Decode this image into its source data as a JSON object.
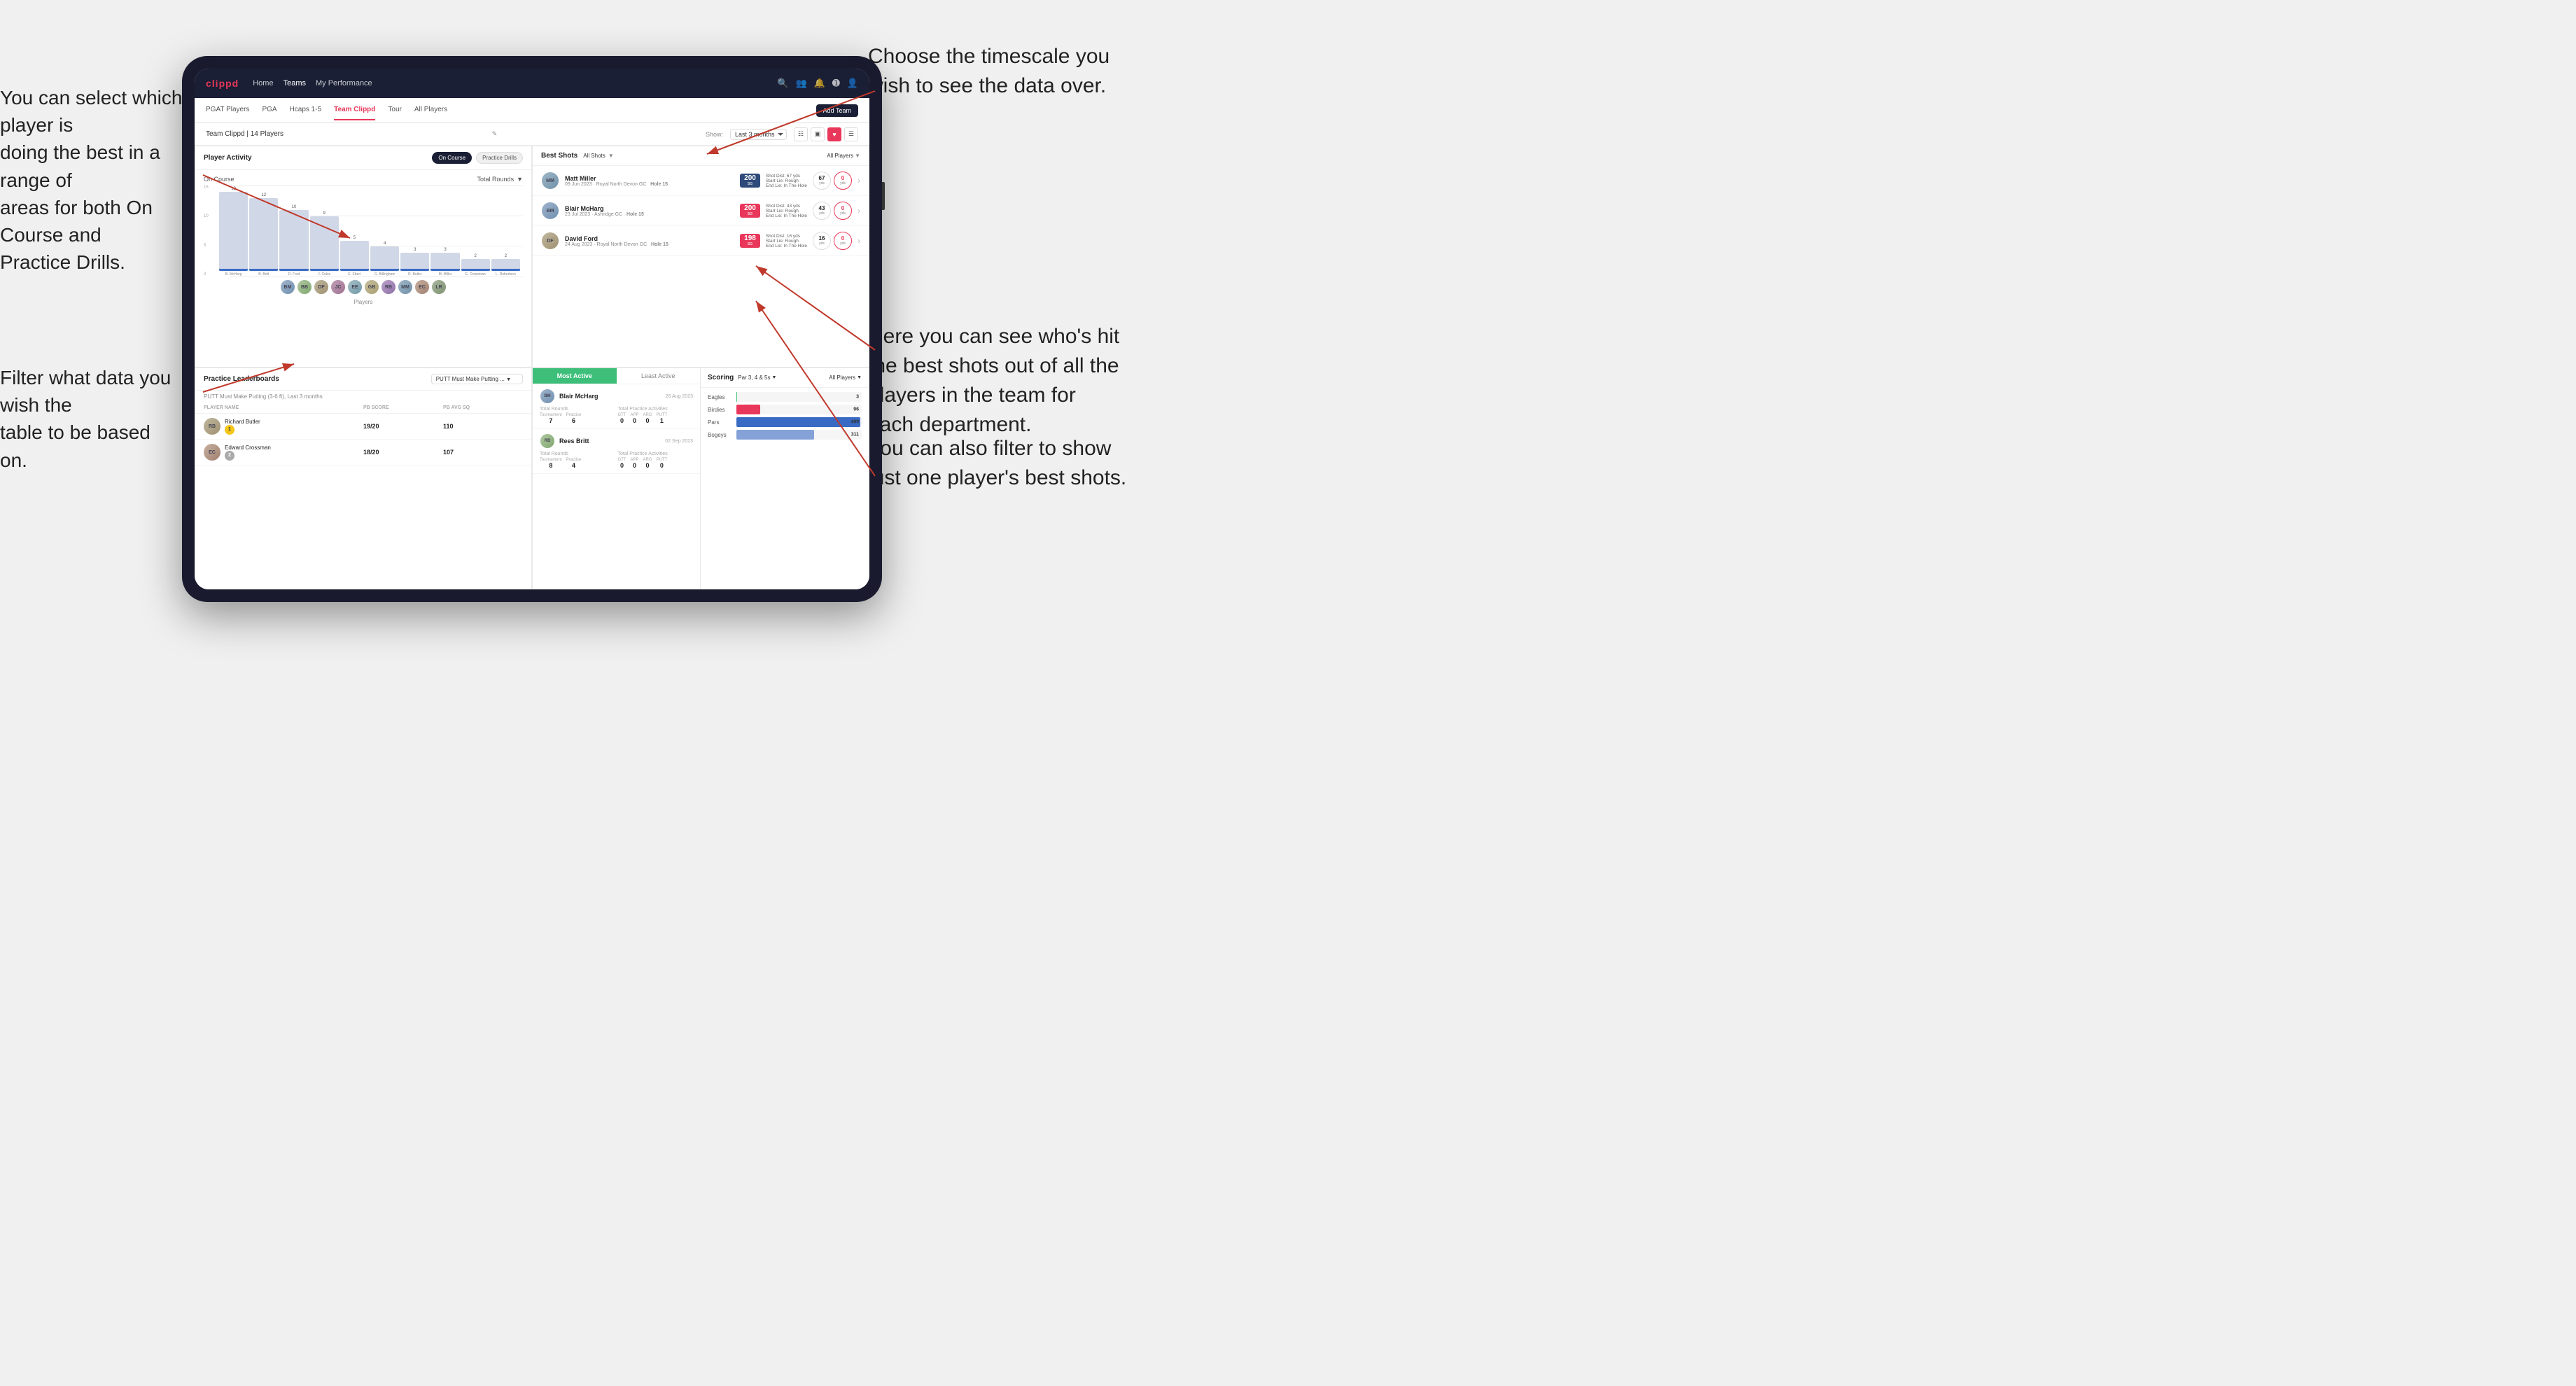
{
  "annotations": {
    "top_right": "Choose the timescale you\nwish to see the data over.",
    "top_left": "You can select which player is\ndoing the best in a range of\nareas for both On Course and\nPractice Drills.",
    "bottom_left": "Filter what data you wish the\ntable to be based on.",
    "mid_right": "Here you can see who's hit\nthe best shots out of all the\nplayers in the team for\neach department.",
    "bottom_right": "You can also filter to show\njust one player's best shots."
  },
  "navbar": {
    "brand": "clippd",
    "links": [
      "Home",
      "Teams",
      "My Performance"
    ],
    "icons": [
      "search",
      "people",
      "bell",
      "plus",
      "user"
    ]
  },
  "subtabs": {
    "tabs": [
      "PGAT Players",
      "PGA",
      "Hcaps 1-5",
      "Team Clippd",
      "Tour",
      "All Players"
    ],
    "active": "Team Clippd",
    "add_button": "Add Team"
  },
  "team_header": {
    "name": "Team Clippd | 14 Players",
    "show_label": "Show:",
    "show_value": "Last 3 months",
    "view_options": [
      "grid-lines",
      "grid",
      "heart",
      "list"
    ]
  },
  "player_activity": {
    "title": "Player Activity",
    "buttons": [
      "On Course",
      "Practice Drills"
    ],
    "active_button": "On Course",
    "section_title": "On Course",
    "metric": "Total Rounds",
    "y_labels": [
      "15",
      "10",
      "5",
      "0"
    ],
    "bars": [
      {
        "label": "B. McHarg",
        "value": 13,
        "height": 87
      },
      {
        "label": "B. Britt",
        "value": 12,
        "height": 80
      },
      {
        "label": "D. Ford",
        "value": 10,
        "height": 67
      },
      {
        "label": "J. Coles",
        "value": 9,
        "height": 60
      },
      {
        "label": "E. Ebert",
        "value": 5,
        "height": 33
      },
      {
        "label": "G. Billingham",
        "value": 4,
        "height": 27
      },
      {
        "label": "R. Butler",
        "value": 3,
        "height": 20
      },
      {
        "label": "M. Miller",
        "value": 3,
        "height": 20
      },
      {
        "label": "E. Crossman",
        "value": 2,
        "height": 13
      },
      {
        "label": "L. Robertson",
        "value": 2,
        "height": 13
      }
    ],
    "x_label": "Players"
  },
  "best_shots": {
    "title": "Best Shots",
    "filter1": "All Shots",
    "filter2": "All Players",
    "players": [
      {
        "name": "Matt Miller",
        "date": "09 Jun 2023",
        "course": "Royal North Devon GC",
        "hole": "Hole 15",
        "badge_value": "200",
        "badge_label": "SG",
        "badge_color": "green",
        "shot_dist": "Shot Dist: 67 yds",
        "start_lie": "Start Lie: Rough",
        "end_lie": "End Lie: In The Hole",
        "yds1": "67",
        "yds2": "0"
      },
      {
        "name": "Blair McHarg",
        "date": "23 Jul 2023",
        "course": "Ashridge GC",
        "hole": "Hole 15",
        "badge_value": "200",
        "badge_label": "SG",
        "badge_color": "pink",
        "shot_dist": "Shot Dist: 43 yds",
        "start_lie": "Start Lie: Rough",
        "end_lie": "End Lie: In The Hole",
        "yds1": "43",
        "yds2": "0"
      },
      {
        "name": "David Ford",
        "date": "24 Aug 2023",
        "course": "Royal North Devon GC",
        "hole": "Hole 15",
        "badge_value": "198",
        "badge_label": "SG",
        "badge_color": "pink",
        "shot_dist": "Shot Dist: 16 yds",
        "start_lie": "Start Lie: Rough",
        "end_lie": "End Lie: In The Hole",
        "yds1": "16",
        "yds2": "0"
      }
    ]
  },
  "practice_leaderboards": {
    "title": "Practice Leaderboards",
    "filter": "PUTT Must Make Putting ...",
    "subtitle": "PUTT Must Make Putting (3-6 ft), Last 3 months",
    "columns": [
      "PLAYER NAME",
      "PB SCORE",
      "PB AVG SQ"
    ],
    "players": [
      {
        "name": "Richard Butler",
        "rank": 1,
        "rank_type": "gold",
        "pb_score": "19/20",
        "pb_avg": "110"
      },
      {
        "name": "Edward Crossman",
        "rank": 2,
        "rank_type": "silver",
        "pb_score": "18/20",
        "pb_avg": "107"
      }
    ]
  },
  "most_active": {
    "tabs": [
      "Most Active",
      "Least Active"
    ],
    "active_tab": "Most Active",
    "players": [
      {
        "name": "Blair McHarg",
        "date": "26 Aug 2023",
        "total_rounds_label": "Total Rounds",
        "tournament": 7,
        "practice": 6,
        "practice_activities_label": "Total Practice Activities",
        "gtt": 0,
        "app": 0,
        "arg": 0,
        "putt": 1
      },
      {
        "name": "Rees Britt",
        "date": "02 Sep 2023",
        "total_rounds_label": "Total Rounds",
        "tournament": 8,
        "practice": 4,
        "practice_activities_label": "Total Practice Activities",
        "gtt": 0,
        "app": 0,
        "arg": 0,
        "putt": 0
      }
    ]
  },
  "scoring": {
    "title": "Scoring",
    "filter": "Par 3, 4 & 5s",
    "players_filter": "All Players",
    "bars": [
      {
        "label": "Eagles",
        "value": 3,
        "max": 500,
        "color": "#3dbf7a"
      },
      {
        "label": "Birdies",
        "value": 96,
        "max": 500,
        "color": "#e8375a"
      },
      {
        "label": "Pars",
        "value": 499,
        "max": 500,
        "color": "#3a6bc4"
      },
      {
        "label": "Bogeys",
        "value": 311,
        "max": 500,
        "color": "#f0c040"
      }
    ]
  }
}
